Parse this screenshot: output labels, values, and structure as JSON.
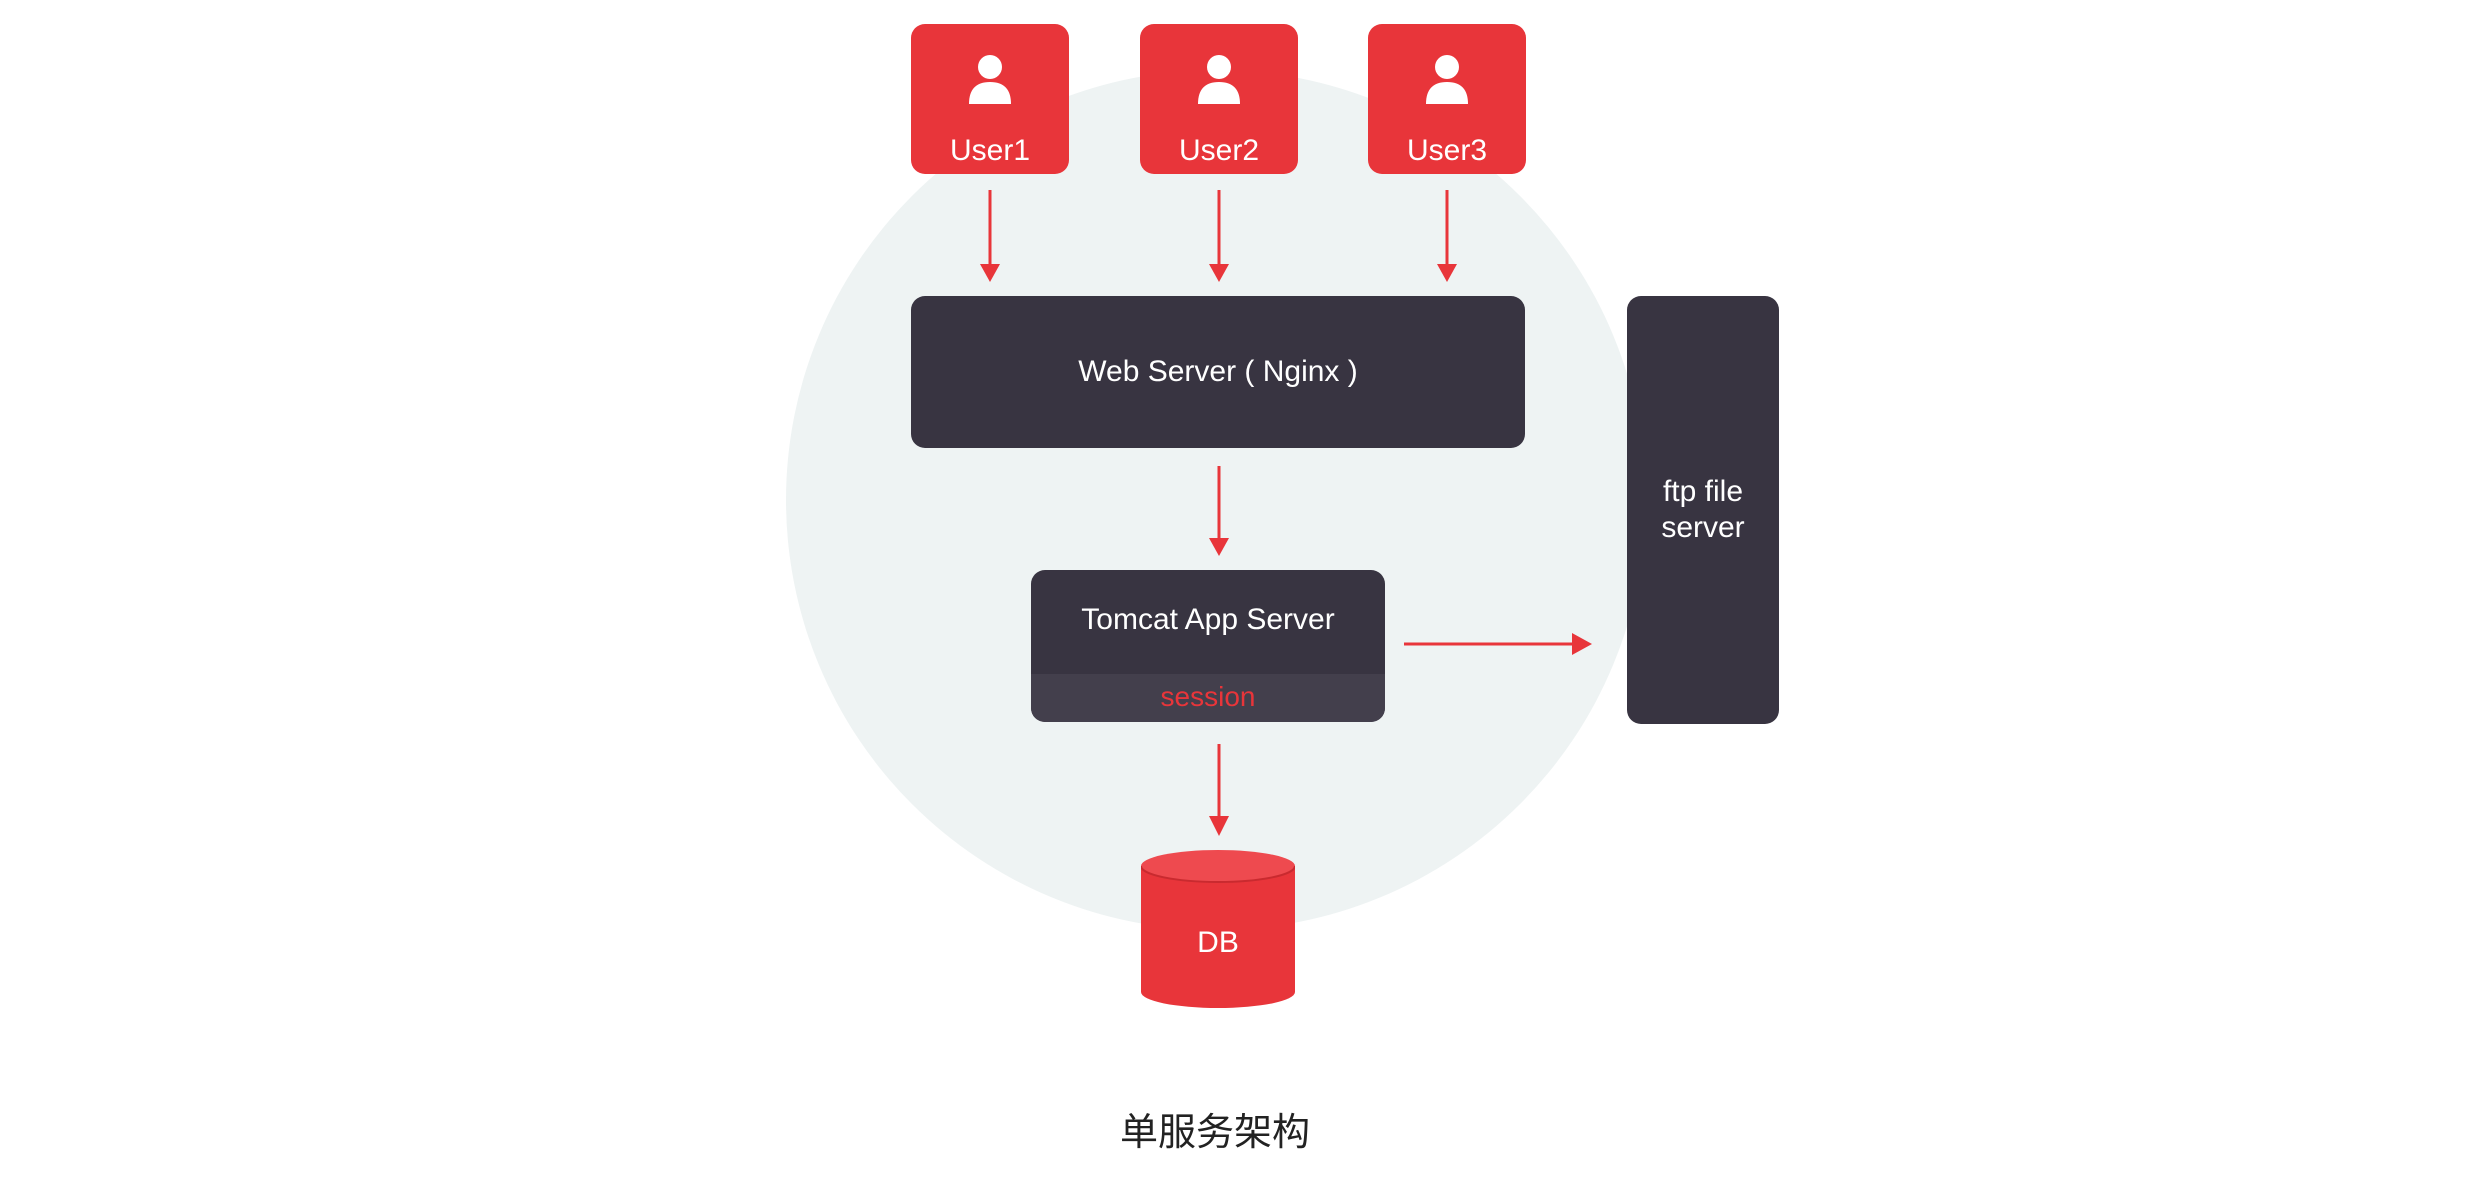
{
  "diagram": {
    "users": [
      {
        "label": "User1",
        "icon": "person-icon"
      },
      {
        "label": "User2",
        "icon": "person-icon"
      },
      {
        "label": "User3",
        "icon": "person-icon"
      }
    ],
    "web_server": {
      "label": "Web Server ( Nginx )"
    },
    "app_server": {
      "label": "Tomcat App Server",
      "sub_label": "session"
    },
    "file_server": {
      "line1": "ftp file",
      "line2": "server"
    },
    "database": {
      "label": "DB"
    },
    "caption": "单服务架构"
  },
  "colors": {
    "accent_red": "#e8353a",
    "dark_box": "#383441",
    "background_circle": "#eef3f3"
  }
}
